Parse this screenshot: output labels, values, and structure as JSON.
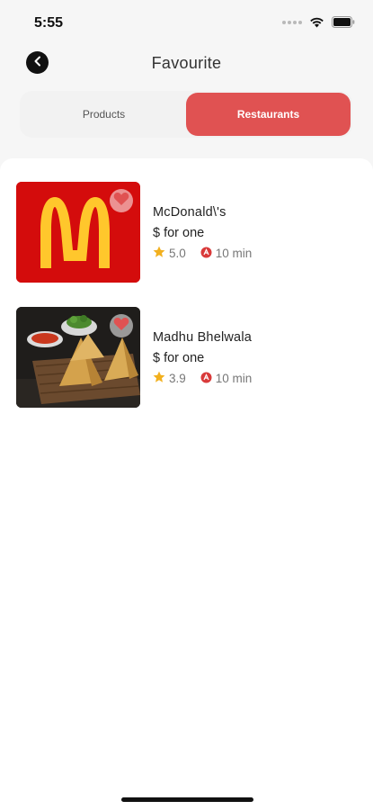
{
  "status_bar": {
    "time": "5:55"
  },
  "header": {
    "title": "Favourite"
  },
  "tabs": [
    {
      "label": "Products",
      "active": false
    },
    {
      "label": "Restaurants",
      "active": true
    }
  ],
  "restaurants": [
    {
      "name": "McDonald\\'s",
      "price": "$ for one",
      "rating": "5.0",
      "time": "10 min"
    },
    {
      "name": "Madhu Bhelwala",
      "price": "$ for one",
      "rating": "3.9",
      "time": "10 min"
    }
  ],
  "colors": {
    "accent": "#e05252",
    "star": "#f2b01e",
    "mcd_red": "#d40c0c",
    "mcd_yellow": "#ffc72c"
  }
}
